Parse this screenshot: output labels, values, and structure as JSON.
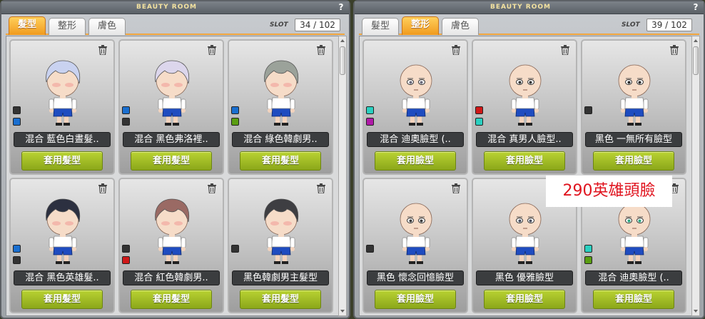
{
  "colors": {
    "tab_active": "#f09a1e",
    "apply_button": "#a3bd26",
    "name_bar": "#3b3d3f",
    "annotation_text": "#e0141f"
  },
  "left_window": {
    "title": "BEAUTY ROOM",
    "help_icon": "?",
    "tabs": [
      {
        "label": "髮型",
        "active": true
      },
      {
        "label": "整形",
        "active": false
      },
      {
        "label": "膚色",
        "active": false
      }
    ],
    "slot_label": "SLOT",
    "slot_value": "34 / 102",
    "items": [
      {
        "name": "混合 藍色白晝髮..",
        "button": "套用髮型",
        "hair": "#c9d2f0",
        "swatches": [
          "#333333",
          "#1a6fd0"
        ]
      },
      {
        "name": "混合 黑色弗洛裡..",
        "button": "套用髮型",
        "hair": "#dcd6ec",
        "swatches": [
          "#1a6fd0",
          "#333333"
        ]
      },
      {
        "name": "混合 綠色韓劇男..",
        "button": "套用髮型",
        "hair": "#9ba29a",
        "swatches": [
          "#1a6fd0",
          "#5a9e12"
        ]
      },
      {
        "name": "混合 黑色英雄髮..",
        "button": "套用髮型",
        "hair": "#2c3040",
        "swatches": [
          "#1a6fd0",
          "#333333"
        ]
      },
      {
        "name": "混合 紅色韓劇男..",
        "button": "套用髮型",
        "hair": "#9a6a64",
        "swatches": [
          "#333333",
          "#d01818"
        ]
      },
      {
        "name": "黑色韓劇男主髮型",
        "button": "套用髮型",
        "hair": "#3e3e42",
        "swatches": [
          "#333333"
        ]
      }
    ]
  },
  "right_window": {
    "title": "BEAUTY ROOM",
    "help_icon": "?",
    "tabs": [
      {
        "label": "髮型",
        "active": false
      },
      {
        "label": "整形",
        "active": true
      },
      {
        "label": "膚色",
        "active": false
      }
    ],
    "slot_label": "SLOT",
    "slot_value": "39 / 102",
    "items": [
      {
        "name": "混合 迪奧臉型 (..",
        "button": "套用臉型",
        "eyes": "#6a6a7a",
        "swatches": [
          "#2ad0c0",
          "#b01aa8"
        ]
      },
      {
        "name": "混合 真男人臉型..",
        "button": "套用臉型",
        "eyes": "#333333",
        "swatches": [
          "#d01818",
          "#2ad0c0"
        ]
      },
      {
        "name": "黑色 一無所有臉型",
        "button": "套用臉型",
        "eyes": "#2a2a2a",
        "swatches": [
          "#333333"
        ]
      },
      {
        "name": "黑色 懷念回憶臉型",
        "button": "套用臉型",
        "eyes": "#3a3a3a",
        "swatches": [
          "#333333"
        ]
      },
      {
        "name": "黑色 優雅臉型",
        "button": "套用臉型",
        "eyes": "#4a5060",
        "swatches": []
      },
      {
        "name": "混合 迪奧臉型 (..",
        "button": "套用臉型",
        "eyes": "#2aa880",
        "swatches": [
          "#2ad0c0",
          "#5a9e12"
        ]
      }
    ]
  },
  "annotation": "290英雄頭臉"
}
